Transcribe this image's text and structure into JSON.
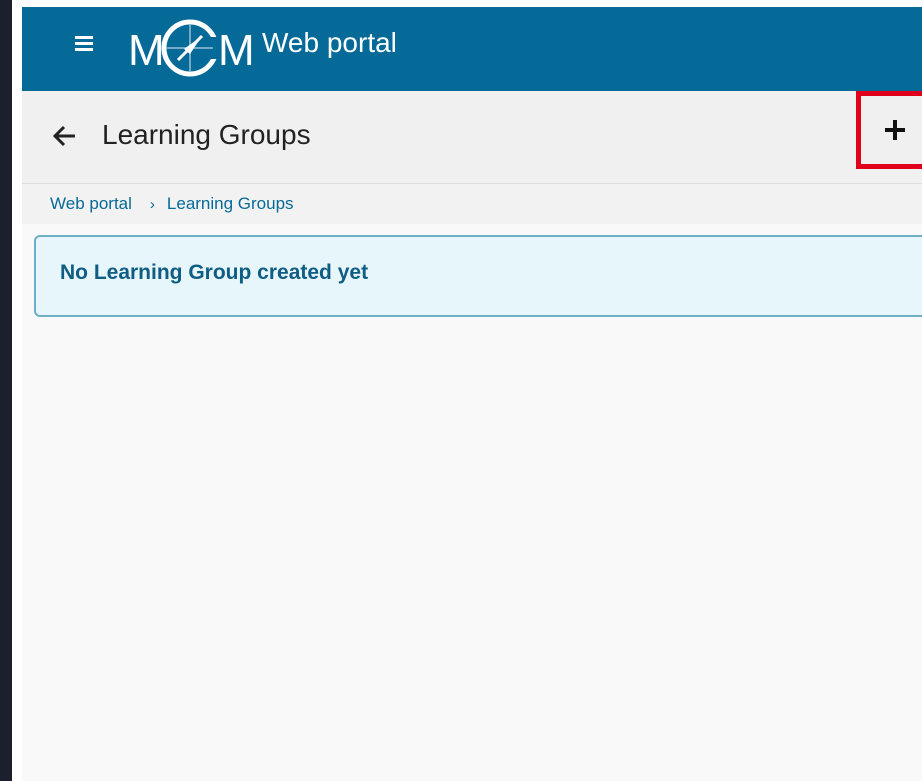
{
  "header": {
    "logo_text": "MCM",
    "title": "Web portal",
    "colors": {
      "brand": "#066a98"
    },
    "menu_icon": "hamburger-menu-icon"
  },
  "subheader": {
    "title": "Learning Groups",
    "back_icon": "arrow-left-icon",
    "add_icon": "plus-icon",
    "add_label": "+",
    "highlight_color": "#e0001b"
  },
  "breadcrumb": {
    "items": [
      "Web portal",
      "Learning Groups"
    ],
    "separator": "›"
  },
  "alert": {
    "message": "No Learning Group created yet",
    "colors": {
      "background": "#e6f6fb",
      "border": "#6bb0c4",
      "text": "#0f5d85"
    }
  }
}
